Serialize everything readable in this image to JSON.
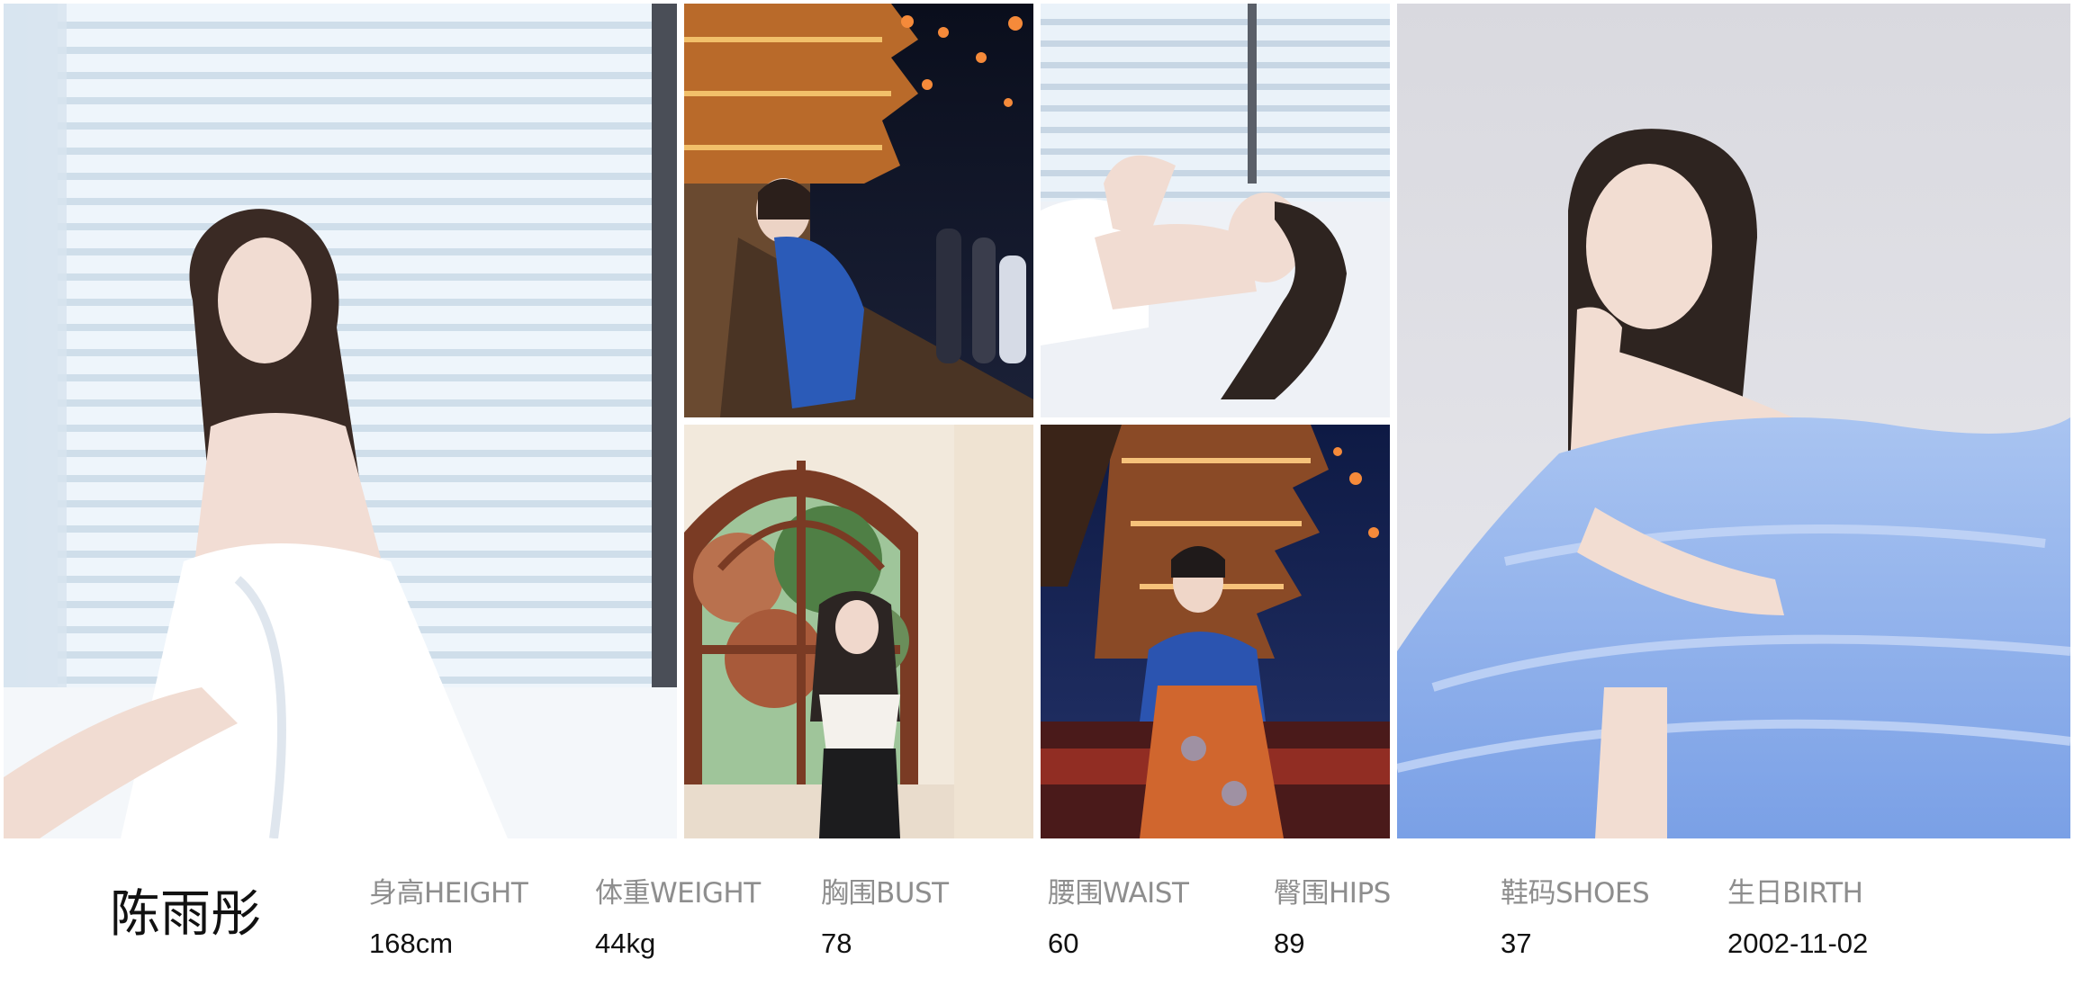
{
  "profile": {
    "name": "陈雨彤",
    "stats": [
      {
        "label": "身高HEIGHT",
        "value": "168cm"
      },
      {
        "label": "体重WEIGHT",
        "value": "44kg"
      },
      {
        "label": "胸围BUST",
        "value": "78"
      },
      {
        "label": "腰围WAIST",
        "value": "60"
      },
      {
        "label": "臀围HIPS",
        "value": "89"
      },
      {
        "label": "鞋码SHOES",
        "value": "37"
      },
      {
        "label": "生日BIRTH",
        "value": "2002-11-02"
      }
    ]
  },
  "photos": [
    {
      "subject": "portrait-white-sheet-window-blinds",
      "palette": [
        "#e8f1f8",
        "#ffffff",
        "#3a2a24"
      ]
    },
    {
      "subject": "night-pagoda-blue-hanfu-lanterns",
      "palette": [
        "#0c1020",
        "#c8762a",
        "#2b5bb8"
      ]
    },
    {
      "subject": "reclining-white-sheet-blinds",
      "palette": [
        "#dfe9f3",
        "#ffffff",
        "#2e2420"
      ]
    },
    {
      "subject": "arched-window-black-white-top",
      "palette": [
        "#f2e9dc",
        "#7a3b24",
        "#3f6a3a"
      ]
    },
    {
      "subject": "night-pagoda-hanfu-orange-skirt",
      "palette": [
        "#13214a",
        "#d0662e",
        "#2b54b0"
      ]
    },
    {
      "subject": "portrait-blue-tulle-dress",
      "palette": [
        "#e9e9ee",
        "#8fb1ec",
        "#2e2420"
      ]
    }
  ]
}
